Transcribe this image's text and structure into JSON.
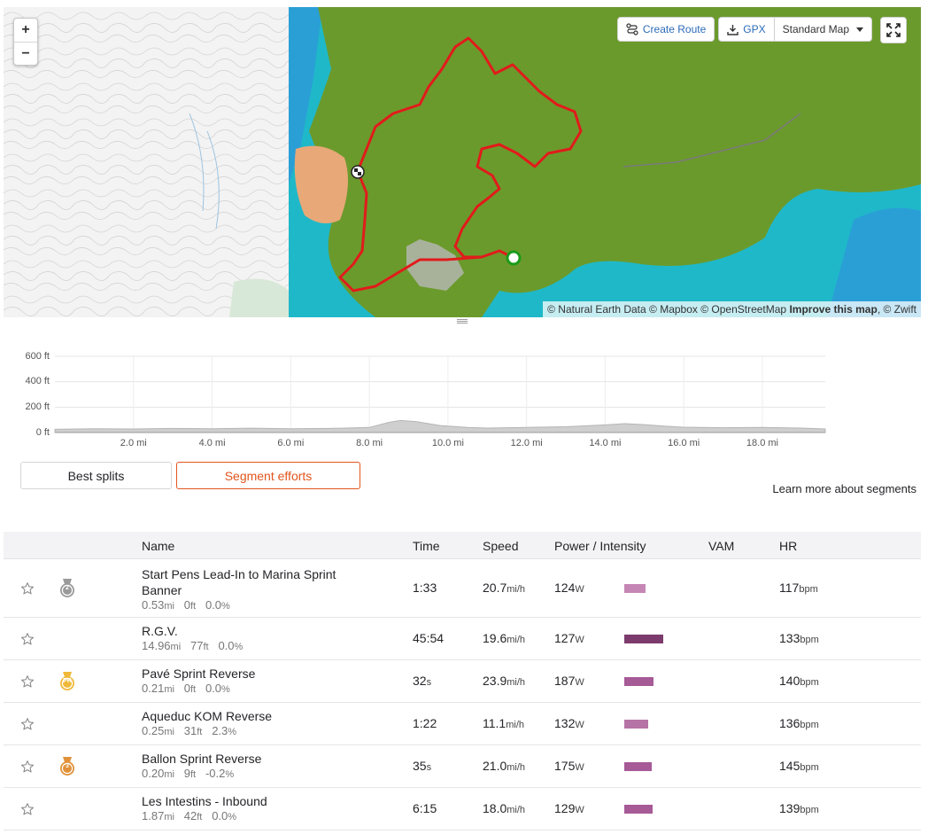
{
  "map": {
    "zoom_in": "+",
    "zoom_out": "−",
    "create_route": "Create Route",
    "gpx": "GPX",
    "map_type": "Standard Map",
    "attribution_prefix": "© Natural Earth Data © Mapbox © OpenStreetMap ",
    "attribution_link": "Improve this map",
    "attribution_suffix": ", © Zwift",
    "icons": [
      "create-route-icon",
      "download-icon",
      "caret-down-icon",
      "fullscreen-icon",
      "start-marker-icon",
      "finish-flag-icon"
    ]
  },
  "elevation": {
    "y_labels": [
      "600 ft",
      "400 ft",
      "200 ft",
      "0 ft"
    ],
    "x_labels": [
      "2.0 mi",
      "4.0 mi",
      "6.0 mi",
      "8.0 mi",
      "10.0 mi",
      "12.0 mi",
      "14.0 mi",
      "16.0 mi",
      "18.0 mi"
    ]
  },
  "chart_data": {
    "type": "area",
    "title": "",
    "xlabel": "",
    "ylabel": "",
    "x_unit": "mi",
    "y_unit": "ft",
    "ylim": [
      0,
      600
    ],
    "xlim": [
      0,
      19.6
    ],
    "grid": true,
    "x": [
      0,
      1,
      2,
      3,
      4,
      5,
      6,
      7,
      8,
      8.5,
      8.8,
      9.2,
      9.8,
      10.5,
      11,
      12,
      13,
      14,
      14.5,
      15,
      15.5,
      16,
      17,
      18,
      19,
      19.6
    ],
    "y": [
      25,
      30,
      28,
      32,
      30,
      34,
      30,
      32,
      40,
      80,
      95,
      85,
      55,
      40,
      35,
      40,
      45,
      60,
      70,
      62,
      50,
      42,
      38,
      40,
      35,
      28
    ]
  },
  "tabs": {
    "best_splits": "Best splits",
    "segment_efforts": "Segment efforts",
    "learn_more": "Learn more about segments"
  },
  "table": {
    "headers": {
      "name": "Name",
      "time": "Time",
      "speed": "Speed",
      "power": "Power / Intensity",
      "vam": "VAM",
      "hr": "HR"
    },
    "rows": [
      {
        "name": "Start Pens Lead-In to Marina Sprint Banner",
        "medal": "2",
        "distance": "0.53",
        "distance_unit": "mi",
        "elev": "0",
        "elev_unit": "ft",
        "grade": "0.0",
        "grade_unit": "%",
        "time": "1:33",
        "time_unit": "",
        "speed": "20.7",
        "speed_unit": "mi/h",
        "power": "124",
        "power_unit": "W",
        "intensity": 0.32,
        "intensity_color": "#c586b5",
        "hr": "117",
        "hr_unit": "bpm"
      },
      {
        "name": "R.G.V.",
        "medal": "",
        "distance": "14.96",
        "distance_unit": "mi",
        "elev": "77",
        "elev_unit": "ft",
        "grade": "0.0",
        "grade_unit": "%",
        "time": "45:54",
        "time_unit": "",
        "speed": "19.6",
        "speed_unit": "mi/h",
        "power": "127",
        "power_unit": "W",
        "intensity": 0.6,
        "intensity_color": "#7c3b6c",
        "hr": "133",
        "hr_unit": "bpm"
      },
      {
        "name": "Pavé Sprint Reverse",
        "medal": "PR",
        "distance": "0.21",
        "distance_unit": "mi",
        "elev": "0",
        "elev_unit": "ft",
        "grade": "0.0",
        "grade_unit": "%",
        "time": "32",
        "time_unit": "s",
        "speed": "23.9",
        "speed_unit": "mi/h",
        "power": "187",
        "power_unit": "W",
        "intensity": 0.44,
        "intensity_color": "#a65a96",
        "hr": "140",
        "hr_unit": "bpm"
      },
      {
        "name": "Aqueduc KOM Reverse",
        "medal": "",
        "distance": "0.25",
        "distance_unit": "mi",
        "elev": "31",
        "elev_unit": "ft",
        "grade": "2.3",
        "grade_unit": "%",
        "time": "1:22",
        "time_unit": "",
        "speed": "11.1",
        "speed_unit": "mi/h",
        "power": "132",
        "power_unit": "W",
        "intensity": 0.36,
        "intensity_color": "#b673a6",
        "hr": "136",
        "hr_unit": "bpm"
      },
      {
        "name": "Ballon Sprint Reverse",
        "medal": "3",
        "distance": "0.20",
        "distance_unit": "mi",
        "elev": "9",
        "elev_unit": "ft",
        "grade": "-0.2",
        "grade_unit": "%",
        "time": "35",
        "time_unit": "s",
        "speed": "21.0",
        "speed_unit": "mi/h",
        "power": "175",
        "power_unit": "W",
        "intensity": 0.42,
        "intensity_color": "#a65a96",
        "hr": "145",
        "hr_unit": "bpm"
      },
      {
        "name": "Les Intestins - Inbound",
        "medal": "",
        "distance": "1.87",
        "distance_unit": "mi",
        "elev": "42",
        "elev_unit": "ft",
        "grade": "0.0",
        "grade_unit": "%",
        "time": "6:15",
        "time_unit": "",
        "speed": "18.0",
        "speed_unit": "mi/h",
        "power": "129",
        "power_unit": "W",
        "intensity": 0.43,
        "intensity_color": "#a65a96",
        "hr": "139",
        "hr_unit": "bpm"
      }
    ]
  }
}
